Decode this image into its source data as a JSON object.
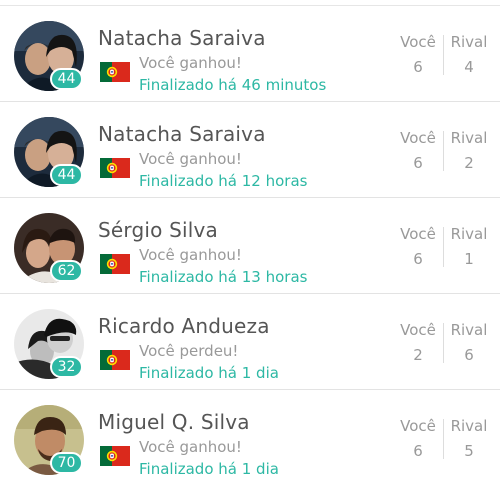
{
  "labels": {
    "you": "Você",
    "rival": "Rival"
  },
  "colors": {
    "accent": "#2db8a4",
    "muted_text": "#999999",
    "name_text": "#555555"
  },
  "matches": [
    {
      "name": "Natacha Saraiva",
      "level": "44",
      "flag": "portugal-flag",
      "result": "Você ganhou!",
      "finished": "Finalizado há 46 minutos",
      "you_score": "6",
      "rival_score": "4"
    },
    {
      "name": "Natacha Saraiva",
      "level": "44",
      "flag": "portugal-flag",
      "result": "Você ganhou!",
      "finished": "Finalizado há 12 horas",
      "you_score": "6",
      "rival_score": "2"
    },
    {
      "name": "Sérgio Silva",
      "level": "62",
      "flag": "portugal-flag",
      "result": "Você ganhou!",
      "finished": "Finalizado há 13 horas",
      "you_score": "6",
      "rival_score": "1"
    },
    {
      "name": "Ricardo Andueza",
      "level": "32",
      "flag": "portugal-flag",
      "result": "Você perdeu!",
      "finished": "Finalizado há 1 dia",
      "you_score": "2",
      "rival_score": "6"
    },
    {
      "name": "Miguel Q. Silva",
      "level": "70",
      "flag": "portugal-flag",
      "result": "Você ganhou!",
      "finished": "Finalizado há 1 dia",
      "you_score": "6",
      "rival_score": "5"
    }
  ]
}
